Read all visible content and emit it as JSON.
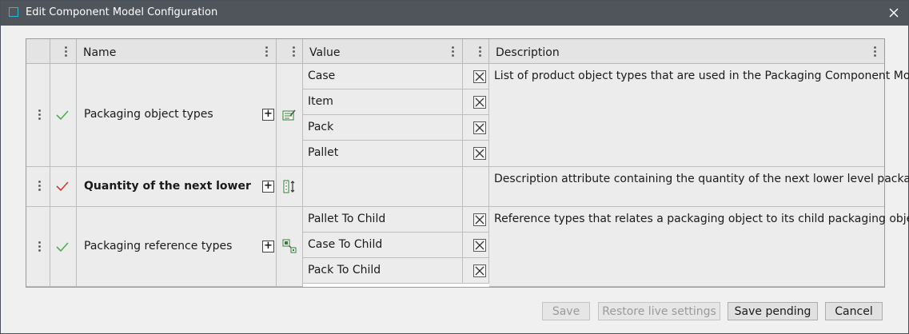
{
  "window": {
    "title": "Edit Component Model Configuration"
  },
  "columns": {
    "name": "Name",
    "value": "Value",
    "description": "Description"
  },
  "rows": [
    {
      "name": "Packaging object types",
      "bold": false,
      "status": "valid",
      "values": [
        "Case",
        "Item",
        "Pack",
        "Pallet"
      ],
      "description": "List of product object types that are used in the Packaging Component Model"
    },
    {
      "name": "Quantity of the next lower",
      "bold": true,
      "status": "pending",
      "values": [],
      "description": "Description attribute containing the quantity of the next lower level packages"
    },
    {
      "name": "Packaging reference types",
      "bold": false,
      "status": "valid",
      "values": [
        "Pallet To Child",
        "Case To Child",
        "Pack To Child"
      ],
      "description": "Reference types that relates a packaging object to its child packaging object"
    }
  ],
  "buttons": {
    "save": "Save",
    "restore": "Restore live settings",
    "save_pending": "Save pending",
    "cancel": "Cancel"
  },
  "colors": {
    "valid_check": "#4caf50",
    "pending_check": "#d9342b",
    "titlebar": "#4f555b"
  }
}
